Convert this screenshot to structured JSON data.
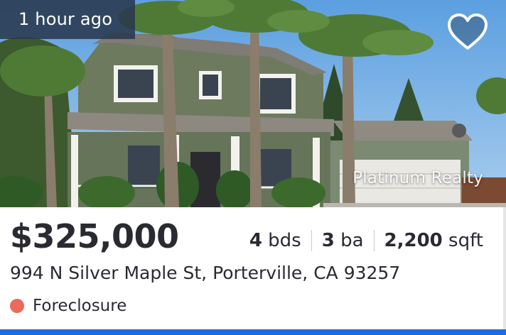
{
  "listing": {
    "time_badge": "1 hour ago",
    "watermark": "Platinum Realty",
    "price": "$325,000",
    "beds_value": "4",
    "beds_unit": " bds",
    "baths_value": "3",
    "baths_unit": " ba",
    "sqft_value": "2,200",
    "sqft_unit": " sqft",
    "address": "994 N Silver Maple St, Porterville, CA 93257",
    "status": "Foreclosure",
    "status_color": "#eb6a5a",
    "favorite_icon": "heart-outline-icon",
    "accent_color": "#1a6fe0"
  }
}
